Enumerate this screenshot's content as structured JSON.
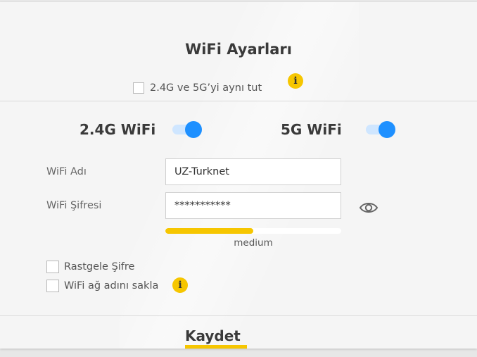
{
  "title": "WiFi Ayarları",
  "sync": {
    "label": "2.4G ve 5G’yi aynı tut",
    "checked": false,
    "info_icon": "i"
  },
  "bands": [
    {
      "label": "2.4G WiFi",
      "enabled": true
    },
    {
      "label": "5G WiFi",
      "enabled": true
    }
  ],
  "form": {
    "ssid_label": "WiFi Adı",
    "ssid_value": "UZ-Turknet",
    "password_label": "WiFi Şifresi",
    "password_value": "***********",
    "strength_text": "medium",
    "strength_fraction": 0.5
  },
  "options": {
    "random_password_label": "Rastgele Şifre",
    "hide_ssid_label": "WiFi ağ adını sakla",
    "info_icon": "i"
  },
  "save_label": "Kaydet",
  "colors": {
    "accent": "#f6c600",
    "toggle": "#1e90ff",
    "toggle_track": "#cfe6ff"
  }
}
